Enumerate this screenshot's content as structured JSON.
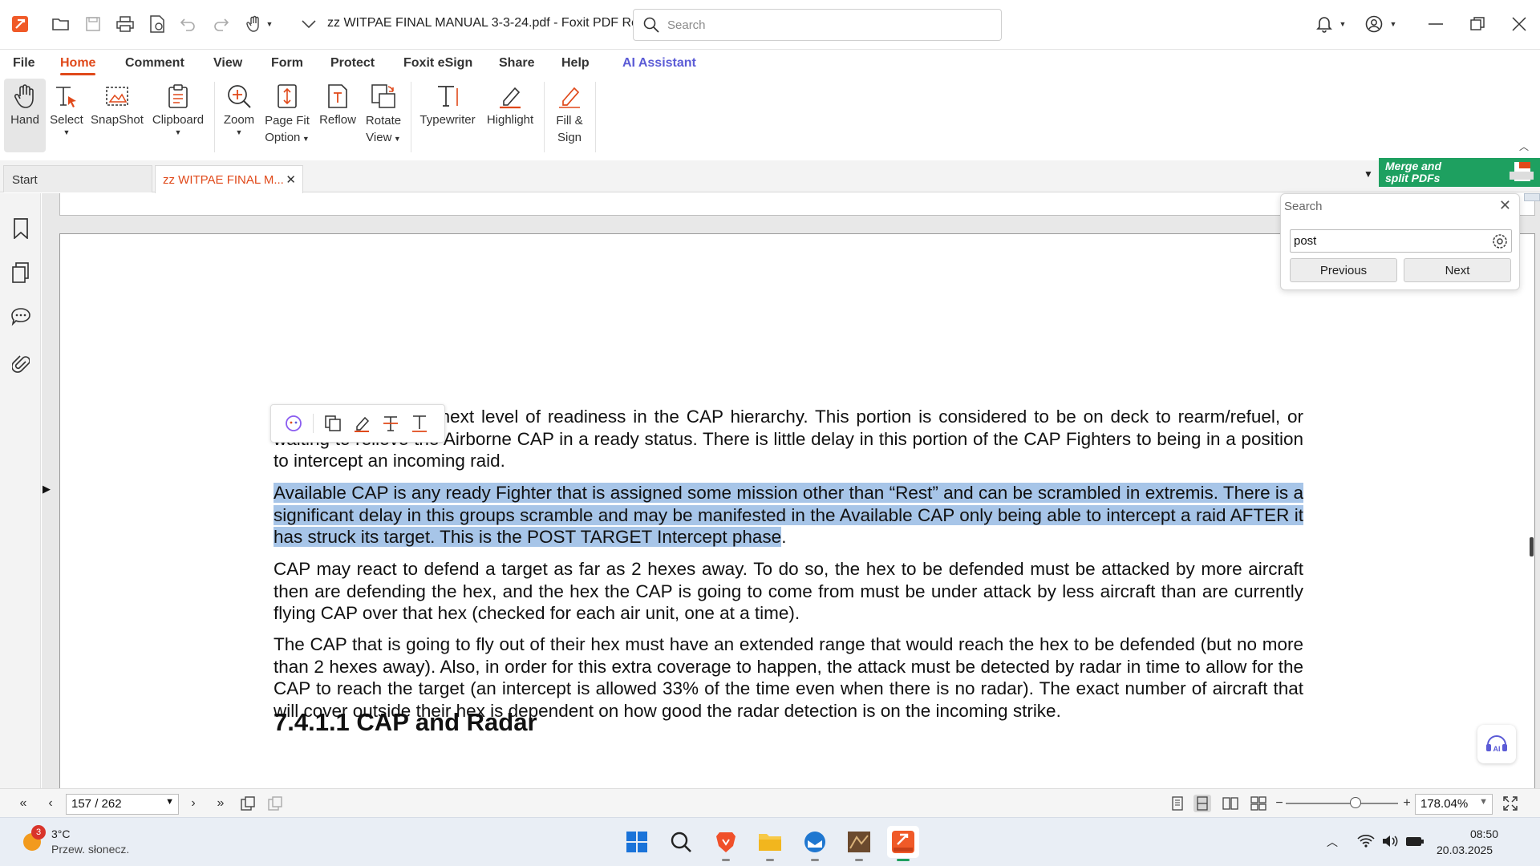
{
  "titlebar": {
    "title": "zz WITPAE FINAL MANUAL 3-3-24.pdf - Foxit PDF Re...",
    "search_placeholder": "Search"
  },
  "menu": {
    "tabs": [
      "File",
      "Home",
      "Comment",
      "View",
      "Form",
      "Protect",
      "Foxit eSign",
      "Share",
      "Help",
      "AI Assistant"
    ],
    "active": "Home"
  },
  "ribbon": {
    "hand": "Hand",
    "select": "Select",
    "snapshot": "SnapShot",
    "clipboard": "Clipboard",
    "zoom": "Zoom",
    "page_fit_1": "Page Fit",
    "page_fit_2": "Option",
    "reflow": "Reflow",
    "rotate_1": "Rotate",
    "rotate_2": "View",
    "typewriter": "Typewriter",
    "highlight": "Highlight",
    "fill_sign_1": "Fill &",
    "fill_sign_2": "Sign"
  },
  "doc_tabs": {
    "start": "Start",
    "current": "zz WITPAE FINAL M...",
    "close": "✕"
  },
  "promo": {
    "line1": "Merge and",
    "line2": "split PDFs"
  },
  "document": {
    "para1": "Ground CAP, is the next level of readiness in the CAP hierarchy.  This portion is considered to be on deck to rearm/refuel, or waiting to relieve the Airborne CAP in a ready status.  There is little delay in this portion of the CAP Fighters to being in a position to intercept an incoming raid.",
    "para2_highlighted": "Available CAP is any ready Fighter that is assigned some mission other than “Rest” and can be scrambled in extremis.  There is a significant delay in this groups scramble and may be manifested in the Available CAP only being able to intercept a raid AFTER it has struck its target.  This is the POST TARGET Intercept phase",
    "para2_tail": ".",
    "para3": "CAP may react to defend a target as far as 2 hexes away. To do so, the hex to be defended must be attacked by more aircraft then are defending the hex, and the hex the CAP is going to come from must be under attack by less aircraft than are currently flying CAP over that hex (checked for each air unit, one at a time).",
    "para4": "The CAP that is going to fly out of their hex must have an extended range that would reach the hex to be defended (but no more than 2 hexes away). Also, in order for this extra coverage to happen, the attack must be detected by radar in time to allow for the CAP to reach the target (an intercept is allowed 33% of the time even when there is no radar). The exact number of aircraft that will cover outside their hex is dependent on how good the radar detection is on the incoming strike.",
    "heading": "7.4.1.1 CAP and Radar"
  },
  "search_panel": {
    "title": "Search",
    "query": "post",
    "previous": "Previous",
    "next": "Next"
  },
  "statusbar": {
    "page": "157 / 262",
    "zoom": "178.04%"
  },
  "taskbar": {
    "weather_temp": "3°C",
    "weather_desc": "Przew. słonecz.",
    "weather_badge": "3",
    "time": "08:50",
    "date": "20.03.2025"
  },
  "colors": {
    "accent": "#e0491a",
    "highlight": "#a7c5e8",
    "promo": "#1ea060",
    "ai": "#5b5bd6"
  }
}
